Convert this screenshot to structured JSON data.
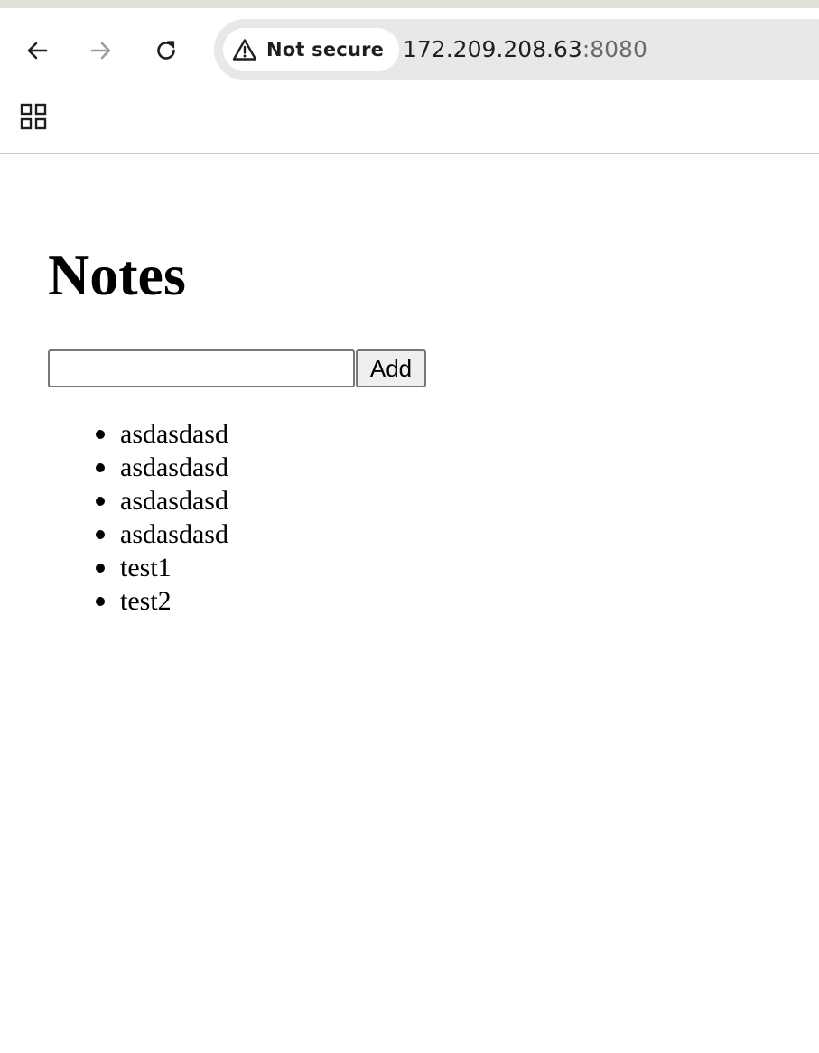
{
  "browser": {
    "security_label": "Not secure",
    "url_host": "172.209.208.63",
    "url_port": ":8080",
    "icons": {
      "back": "back-arrow-icon",
      "forward": "forward-arrow-icon",
      "reload": "reload-icon",
      "warning": "warning-triangle-icon",
      "apps": "apps-grid-icon"
    }
  },
  "page": {
    "title": "Notes",
    "input": {
      "value": "",
      "placeholder": ""
    },
    "add_label": "Add",
    "notes": [
      "asdasdasd",
      "asdasdasd",
      "asdasdasd",
      "asdasdasd",
      "test1",
      "test2"
    ]
  }
}
